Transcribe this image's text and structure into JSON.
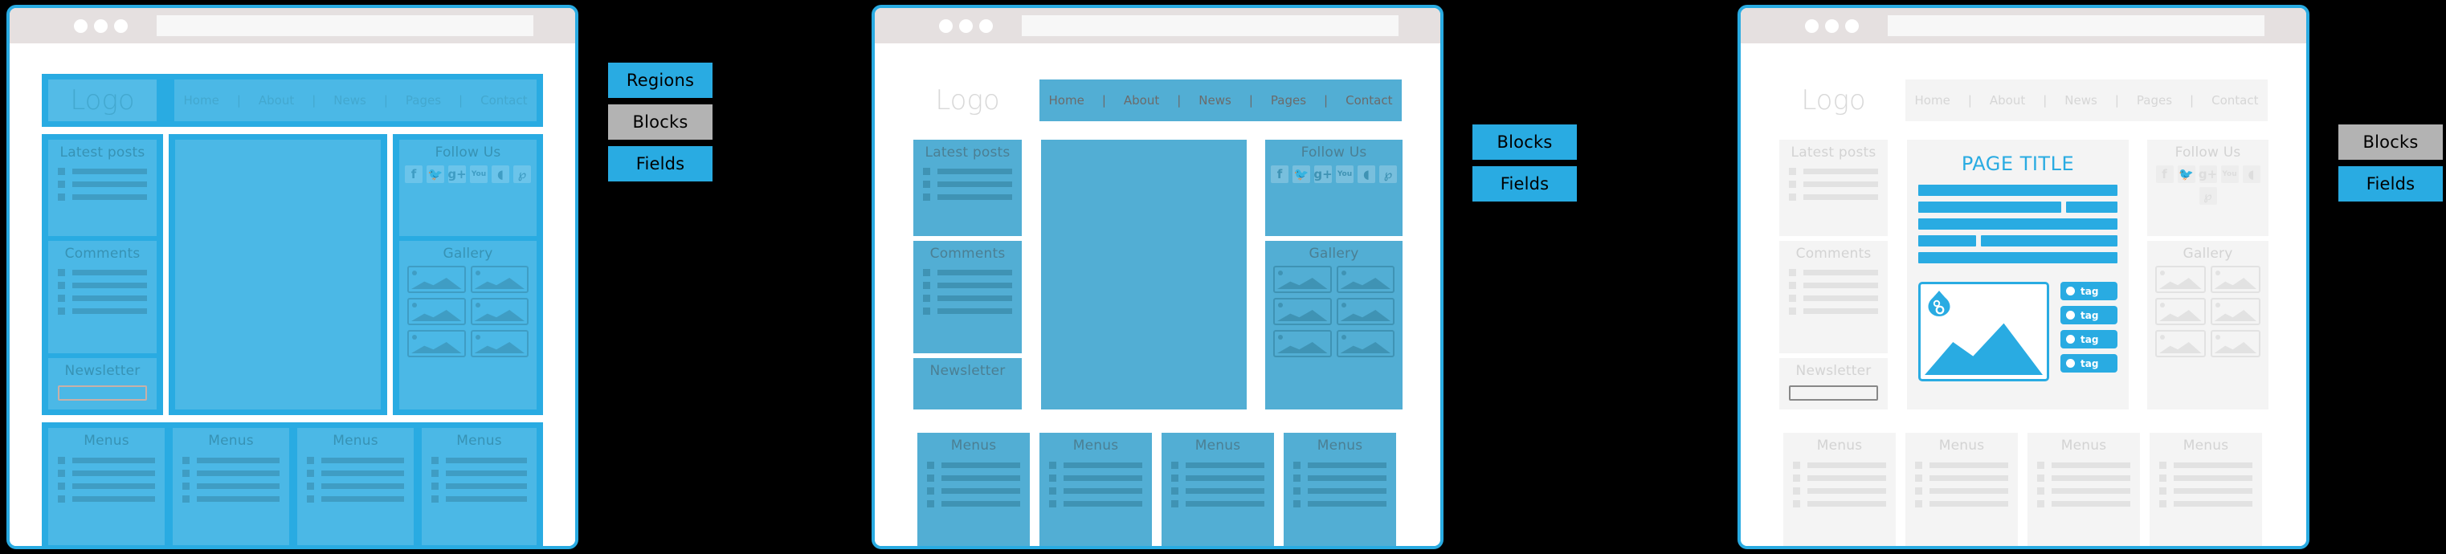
{
  "browser": {
    "dots": 3,
    "urlbar_value": ""
  },
  "site": {
    "logo": "Logo",
    "nav": [
      "Home",
      "About",
      "News",
      "Pages",
      "Contact"
    ],
    "nav_separator": "|",
    "sidebar_left": [
      {
        "title": "Latest posts",
        "rows": 3
      },
      {
        "title": "Comments",
        "rows": 4
      },
      {
        "title": "Newsletter",
        "rows": 0,
        "has_input": true
      }
    ],
    "sidebar_right": [
      {
        "title": "Follow Us",
        "icons": [
          "facebook-icon",
          "twitter-icon",
          "google-plus-icon",
          "youtube-icon",
          "rss-icon",
          "pinterest-icon"
        ],
        "icon_glyphs": [
          "f",
          "ᵛ",
          "g+",
          "You",
          "◖",
          "ơ"
        ]
      },
      {
        "title": "Gallery",
        "images": 6
      }
    ],
    "footer_menus": [
      {
        "title": "Menus",
        "rows": 4
      },
      {
        "title": "Menus",
        "rows": 4
      },
      {
        "title": "Menus",
        "rows": 4
      },
      {
        "title": "Menus",
        "rows": 4
      }
    ]
  },
  "fields_content": {
    "page_title": "PAGE TITLE",
    "body_rows": [
      [
        100
      ],
      [
        72,
        26
      ],
      [
        100
      ],
      [
        29,
        69
      ],
      [
        100
      ]
    ],
    "tags": [
      "tag",
      "tag",
      "tag",
      "tag"
    ],
    "image_alt": "drupal-image-field"
  },
  "groups": [
    {
      "name": "regions-group",
      "buttons": [
        {
          "label": "Regions",
          "style": "blue",
          "active": true
        },
        {
          "label": "Blocks",
          "style": "grey",
          "active": false
        },
        {
          "label": "Fields",
          "style": "blue",
          "active": false
        }
      ]
    },
    {
      "name": "blocks-group",
      "buttons": [
        {
          "label": "Blocks",
          "style": "blue",
          "active": true
        },
        {
          "label": "Fields",
          "style": "blue",
          "active": false
        }
      ]
    },
    {
      "name": "fields-group",
      "buttons": [
        {
          "label": "Blocks",
          "style": "grey",
          "active": false
        },
        {
          "label": "Fields",
          "style": "blue",
          "active": true
        }
      ]
    }
  ],
  "colors": {
    "accent": "#29abe2",
    "block_blue": "#52aed4",
    "grey_button": "#b3b3b3",
    "chrome": "#e5e0e0",
    "background": "#000000",
    "field_grey": "#f4f4f4"
  }
}
